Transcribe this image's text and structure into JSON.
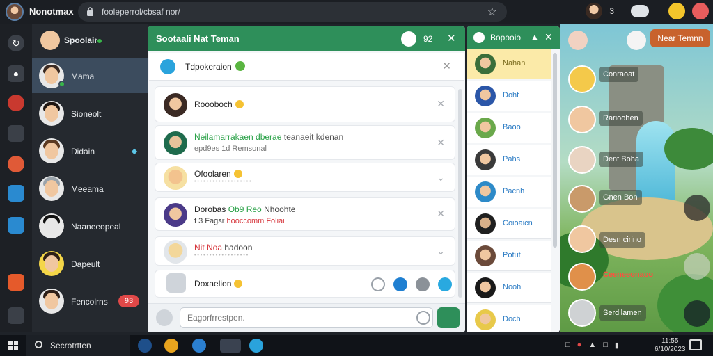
{
  "window": {
    "title": "Nonotmax",
    "url": "fooleperrol/cbsaf nor/"
  },
  "top_icons": [
    "avatar-icon",
    "number-label",
    "cloud-icon",
    "emoji-icon",
    "heart-icon"
  ],
  "top_number": "3",
  "rail": [
    "refresh-icon",
    "gamepad-icon",
    "shield-icon",
    "robot-icon",
    "chat-icon",
    "puzzle-icon",
    "folder-icon",
    "gift-icon",
    "grid-icon"
  ],
  "contacts": {
    "header_name": "Spoolain",
    "items": [
      {
        "name": "Mama",
        "active": true
      },
      {
        "name": "Sioneolt",
        "active": false
      },
      {
        "name": "Didain",
        "active": false,
        "marker": "diamond"
      },
      {
        "name": "Meeama",
        "active": false
      },
      {
        "name": "Naaneeopeal",
        "active": false
      },
      {
        "name": "Dapeult",
        "active": false
      },
      {
        "name": "Fencolrns",
        "active": false,
        "badge": "93"
      }
    ]
  },
  "chat": {
    "title": "Sootaali Nat Teman",
    "nav_count": "92",
    "pinned": "Tdpokeraion",
    "messages": [
      {
        "line1": "Roooboch",
        "line2": "",
        "emoji": true
      },
      {
        "line1_green": "Neilamarrakaen dberae",
        "line1_rest": "teanaeit kdenan",
        "line2": "epd9es 1d Remsonal"
      },
      {
        "line1": "Ofoolaren",
        "line2": "• • • • • • • • • • • • • • • • • • •",
        "emoji": true
      },
      {
        "line1": "Dorobas",
        "line1_green": "Ob9 Reo",
        "line1_rest": "Nhoohte",
        "line2_dark": "f 3 Fagsr",
        "line2_red": "hooccomm Foliai"
      },
      {
        "line1_red": "Nit Noa",
        "line1_rest": "hadoon",
        "line2": "• • • • • • • • • • • • • • • • • •"
      },
      {
        "line1": "Doxaelion",
        "line2": "",
        "emoji": true
      }
    ],
    "composer_placeholder": "Eagorfrrestpen."
  },
  "members": {
    "title": "Bopooio",
    "items": [
      "Nahan",
      "Doht",
      "Baoo",
      "Pahs",
      "Pacnh",
      "Coioaicn",
      "Potut",
      "Nooh",
      "Doch"
    ]
  },
  "scene": {
    "play_button": "Near Temnn",
    "players": [
      {
        "name": "Conraoat",
        "color": "normal"
      },
      {
        "name": "Rarioohen",
        "color": "normal"
      },
      {
        "name": "Dent Boha",
        "color": "normal"
      },
      {
        "name": "Gnen Bon",
        "color": "normal"
      },
      {
        "name": "Desn cirino",
        "color": "normal"
      },
      {
        "name": "Ceeneeonaoo",
        "color": "red"
      },
      {
        "name": "Serdilamen",
        "color": "normal"
      }
    ]
  },
  "taskbar": {
    "search_label": "Secrotrtten",
    "tray": [
      "ink-icon",
      "network-icon",
      "mic-icon",
      "volume-icon",
      "battery-icon"
    ],
    "clock_line1": "11:55",
    "clock_line2": "6/10/2023"
  }
}
